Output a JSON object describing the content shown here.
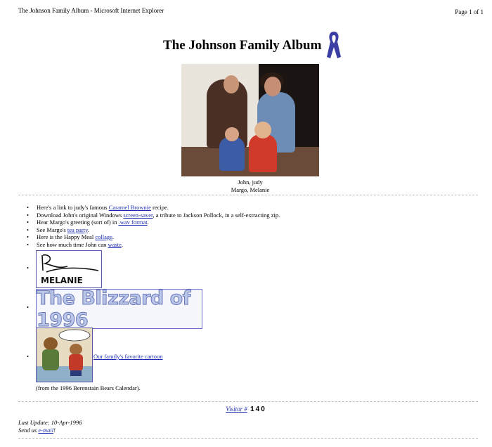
{
  "window": {
    "title": "The Johnson Family Album - Microsoft Internet Explorer",
    "page_indicator": "Page 1 of 1"
  },
  "page": {
    "heading": "The Johnson Family Album",
    "photo_caption_line1": "John, judy",
    "photo_caption_line2": "Margo, Melanie"
  },
  "links": [
    {
      "before": "Here's a link to judy's famous ",
      "link": "Caramel Brownie",
      "after": " recipe."
    },
    {
      "before": "Download John's original Windows ",
      "link": "screen-saver",
      "after": ", a tribute to Jackson Pollock, in a self-extracting zip."
    },
    {
      "before": "Hear Margo's greeting (sort of) in ",
      "link": ".wav format",
      "after": "."
    },
    {
      "before": "See Margo's ",
      "link": "tea party",
      "after": "."
    },
    {
      "before": "Here is the Happy Meal ",
      "link": "collage",
      "after": "."
    },
    {
      "before": "See how much time John can ",
      "link": "waste",
      "after": "."
    }
  ],
  "images": {
    "signature_text": "MELANIE",
    "blizzard_text": "The Blizzard of 1996",
    "cartoon_link": "Our family's favorite cartoon",
    "cartoon_source": "(from the 1996 Berenstain Bears Calendar)."
  },
  "footer": {
    "visitor_label": "Visitor #",
    "visitor_count": "140",
    "last_update": "Last Update: 10-Apr-1996",
    "send_us": "Send us ",
    "email_link": "e-mail",
    "email_after": "!"
  },
  "colors": {
    "link": "#1a2bb0",
    "ribbon": "#3b3fa3",
    "rule": "#b9b9b9"
  }
}
